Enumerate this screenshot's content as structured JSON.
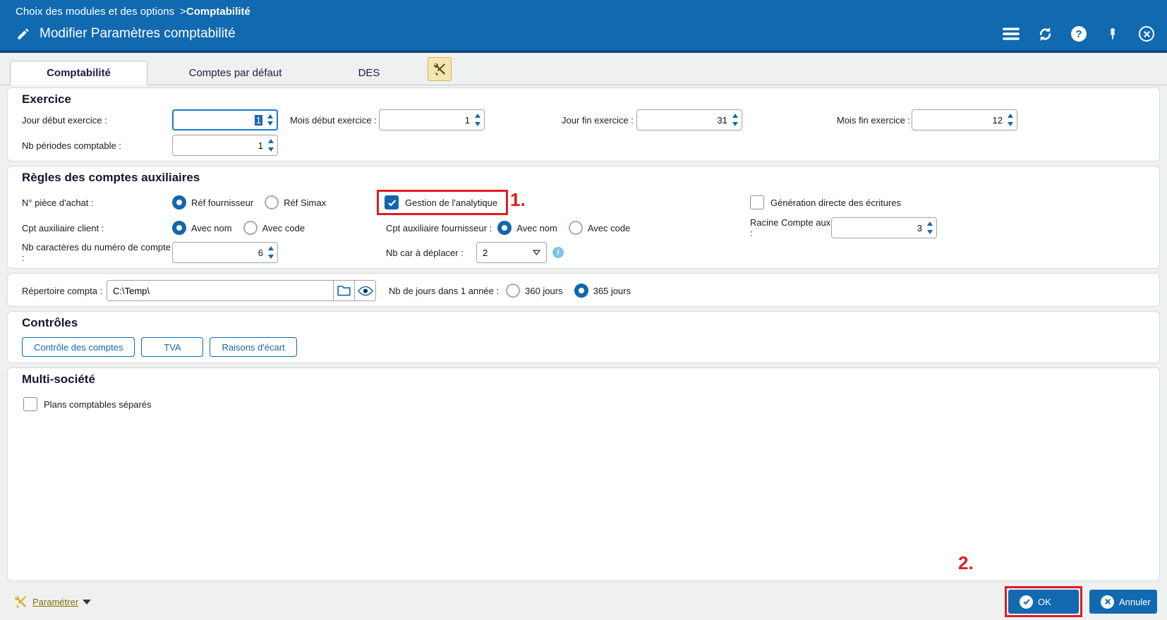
{
  "colors": {
    "header_blue": "#1169b0",
    "accent_blue": "#1266ae",
    "annotation_red": "#e01b22",
    "link_gold": "#8c6d00"
  },
  "breadcrumb": {
    "path": "Choix des modules et des options",
    "sep": ">",
    "current": "Comptabilité"
  },
  "titlebar": {
    "title": "Modifier Paramètres comptabilité",
    "icons": [
      "pencil-icon",
      "menu-icon",
      "sync-icon",
      "help-icon",
      "pin-icon",
      "close-icon"
    ],
    "help_glyph": "?",
    "close_glyph": "✕"
  },
  "tabs": {
    "items": [
      {
        "label": "Comptabilité",
        "active": true
      },
      {
        "label": "Comptes par défaut",
        "active": false
      },
      {
        "label": "DES",
        "active": false
      }
    ],
    "tools_icon": "wrench-screwdriver-icon"
  },
  "exercice": {
    "heading": "Exercice",
    "jour_debut": {
      "label": "Jour début exercice :",
      "value": "1",
      "focused": true
    },
    "mois_debut": {
      "label": "Mois début exercice :",
      "value": "1"
    },
    "jour_fin": {
      "label": "Jour fin exercice :",
      "value": "31"
    },
    "mois_fin": {
      "label": "Mois fin exercice :",
      "value": "12"
    },
    "nb_periodes": {
      "label": "Nb périodes comptable :",
      "value": "1"
    }
  },
  "regles": {
    "heading": "Règles des comptes auxiliaires",
    "piece_achat": {
      "label": "N° pièce d'achat :",
      "options": [
        "Réf fournisseur",
        "Réf Simax"
      ],
      "selected": "Réf fournisseur"
    },
    "gestion_analytique": {
      "label": "Gestion de l'analytique",
      "checked": true
    },
    "generation_directe": {
      "label": "Génération directe des écritures",
      "checked": false
    },
    "aux_client": {
      "label": "Cpt auxiliaire client :",
      "options": [
        "Avec nom",
        "Avec code"
      ],
      "selected": "Avec nom"
    },
    "aux_fournisseur": {
      "label": "Cpt auxiliaire fournisseur :",
      "options": [
        "Avec nom",
        "Avec code"
      ],
      "selected": "Avec nom"
    },
    "racine_compte": {
      "label": "Racine Compte aux :",
      "value": "3"
    },
    "nb_caracteres": {
      "label": "Nb caractères du numéro de compte :",
      "value": "6"
    },
    "nb_car_deplacer": {
      "label": "Nb car à déplacer :",
      "value": "2"
    }
  },
  "repertoire": {
    "label": "Répertoire compta :",
    "value": "C:\\Temp\\",
    "jours_annee": {
      "label": "Nb de jours dans 1 année :",
      "options": [
        "360 jours",
        "365 jours"
      ],
      "selected": "365 jours"
    }
  },
  "controles": {
    "heading": "Contrôles",
    "buttons": [
      "Contrôle des comptes",
      "TVA",
      "Raisons d'écart"
    ]
  },
  "multi_societe": {
    "heading": "Multi-société",
    "plans_separes": {
      "label": "Plans comptables séparés",
      "checked": false
    }
  },
  "footer": {
    "parametrer": "Paramétrer",
    "ok": "OK",
    "annuler": "Annuler"
  },
  "annotations": {
    "step1": "1.",
    "step2": "2."
  }
}
